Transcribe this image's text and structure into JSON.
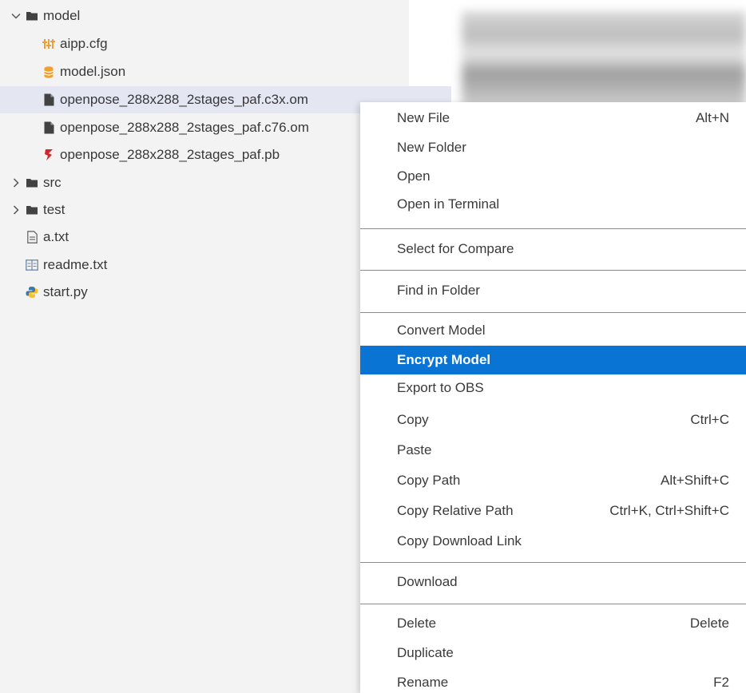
{
  "explorer": {
    "items": [
      {
        "label": "model",
        "type": "folder",
        "expanded": true,
        "icon": "folder-icon"
      },
      {
        "label": "aipp.cfg",
        "type": "file",
        "icon": "config-icon"
      },
      {
        "label": "model.json",
        "type": "file",
        "icon": "database-icon"
      },
      {
        "label": "openpose_288x288_2stages_paf.c3x.om",
        "type": "file",
        "icon": "file-icon",
        "selected": true
      },
      {
        "label": "openpose_288x288_2stages_paf.c76.om",
        "type": "file",
        "icon": "file-icon"
      },
      {
        "label": "openpose_288x288_2stages_paf.pb",
        "type": "file",
        "icon": "tensorflow-icon"
      },
      {
        "label": "src",
        "type": "folder",
        "expanded": false,
        "icon": "folder-icon"
      },
      {
        "label": "test",
        "type": "folder",
        "expanded": false,
        "icon": "folder-icon"
      },
      {
        "label": "a.txt",
        "type": "file",
        "icon": "text-file-icon"
      },
      {
        "label": "readme.txt",
        "type": "file",
        "icon": "readme-icon"
      },
      {
        "label": "start.py",
        "type": "file",
        "icon": "python-icon"
      }
    ]
  },
  "context_menu": {
    "items": [
      {
        "label": "New File",
        "shortcut": "Alt+N"
      },
      {
        "label": "New Folder",
        "shortcut": ""
      },
      {
        "label": "Open",
        "shortcut": ""
      },
      {
        "label": "Open in Terminal",
        "shortcut": ""
      },
      {
        "label": "Select for Compare",
        "shortcut": ""
      },
      {
        "label": "Find in Folder",
        "shortcut": ""
      },
      {
        "label": "Convert Model",
        "shortcut": ""
      },
      {
        "label": "Encrypt Model",
        "shortcut": "",
        "active": true
      },
      {
        "label": "Export to OBS",
        "shortcut": ""
      },
      {
        "label": "Copy",
        "shortcut": "Ctrl+C"
      },
      {
        "label": "Paste",
        "shortcut": ""
      },
      {
        "label": "Copy Path",
        "shortcut": "Alt+Shift+C"
      },
      {
        "label": "Copy Relative Path",
        "shortcut": "Ctrl+K, Ctrl+Shift+C"
      },
      {
        "label": "Copy Download Link",
        "shortcut": ""
      },
      {
        "label": "Download",
        "shortcut": ""
      },
      {
        "label": "Delete",
        "shortcut": "Delete"
      },
      {
        "label": "Duplicate",
        "shortcut": ""
      },
      {
        "label": "Rename",
        "shortcut": "F2"
      }
    ]
  },
  "colors": {
    "highlight": "#0a74d4",
    "selected_row": "#e4e6f1",
    "explorer_bg": "#f3f3f3"
  }
}
